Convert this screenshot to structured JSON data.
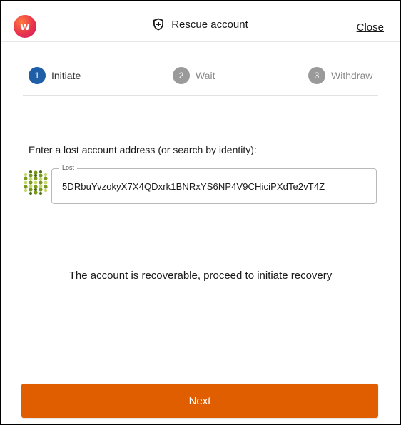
{
  "header": {
    "title": "Rescue account",
    "close_label": "Close",
    "logo_letter": "w",
    "logo_icon": "app-logo-icon",
    "title_icon": "shield-icon"
  },
  "stepper": {
    "steps": [
      {
        "number": "1",
        "label": "Initiate",
        "state": "active"
      },
      {
        "number": "2",
        "label": "Wait",
        "state": "pending"
      },
      {
        "number": "3",
        "label": "Withdraw",
        "state": "pending"
      }
    ]
  },
  "form": {
    "prompt": "Enter a lost account address (or search by identity):",
    "field_legend": "Lost",
    "address": "5DRbuYvzokyX7X4QDxrk1BNRxYS6NP4V9CHiciPXdTe2vT4Z",
    "avatar_icon": "identicon-icon"
  },
  "status": {
    "message": "The account is recoverable, proceed to initiate recovery"
  },
  "actions": {
    "next_label": "Next"
  },
  "colors": {
    "accent": "#e05e00",
    "active_step": "#1e5fa8",
    "pending_step": "#9a9a9a"
  }
}
